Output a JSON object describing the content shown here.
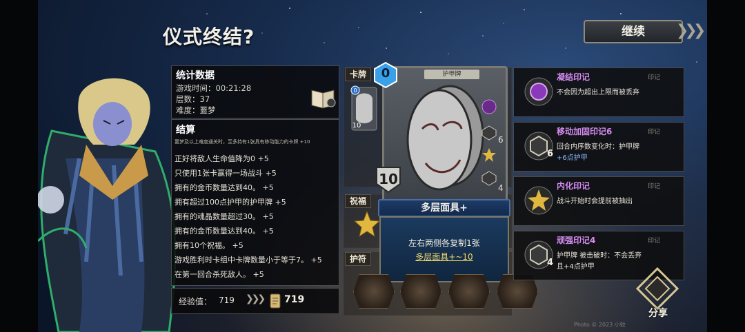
{
  "title": "仪式终结?",
  "continue_button": "继续",
  "stats": {
    "title": "统计数据",
    "play_time_label": "游戏时间：",
    "play_time": "00:21:28",
    "floor_label": "层数：",
    "floor": "37",
    "difficulty_label": "难度：",
    "difficulty": "噩梦"
  },
  "settlement": {
    "title": "结算",
    "note": "噩梦及以上难度通关时，至多持有1张具有移动能力的卡牌 +10",
    "items": [
      "正好将敌人生命值降为0 +5",
      "只使用1张卡赢得一场战斗 +5",
      "拥有的金币数量达到40。 +5",
      "拥有超过100点护甲的护甲牌 +5",
      "拥有的魂晶数量超过30。 +5",
      "拥有的金币数量达到40。 +5",
      "拥有10个祝福。 +5",
      "游戏胜利时卡组中卡牌数量小于等于7。 +5",
      "在第一回合杀死敌人。 +5"
    ]
  },
  "experience": {
    "label": "经验值：",
    "value": "719",
    "total": "719"
  },
  "sections": {
    "cards": "卡牌",
    "blessings": "祝福",
    "relics": "护符"
  },
  "mini_card": {
    "cost": "0",
    "block": "10"
  },
  "card": {
    "type": "护甲牌",
    "cost": "0",
    "block": "10",
    "side_values": [
      "6",
      "4"
    ],
    "name": "多层面具+",
    "desc_line1": "左右两侧各复制1张",
    "desc_line2": "多层面具+~10"
  },
  "marks": [
    {
      "title": "凝结印记",
      "tag": "印记",
      "desc": [
        "不会因为超出上限而被丢弃"
      ],
      "num": "",
      "color": "#a04ad0"
    },
    {
      "title": "移动加固印记6",
      "tag": "印记",
      "desc": [
        "回合内序数变化时：护甲牌",
        "+6点护甲"
      ],
      "num": "6",
      "color": "#c8c4b6"
    },
    {
      "title": "内化印记",
      "tag": "印记",
      "desc": [
        "战斗开始时会提前被抽出"
      ],
      "num": "",
      "color": "#e0b840"
    },
    {
      "title": "顽强印记4",
      "tag": "印记",
      "desc": [
        "护甲牌 被击破时：不会丢弃",
        "且+4点护甲"
      ],
      "num": "4",
      "color": "#c8c4b6"
    }
  ],
  "share": "分享",
  "watermark": "Photo © 2023 小蚊"
}
